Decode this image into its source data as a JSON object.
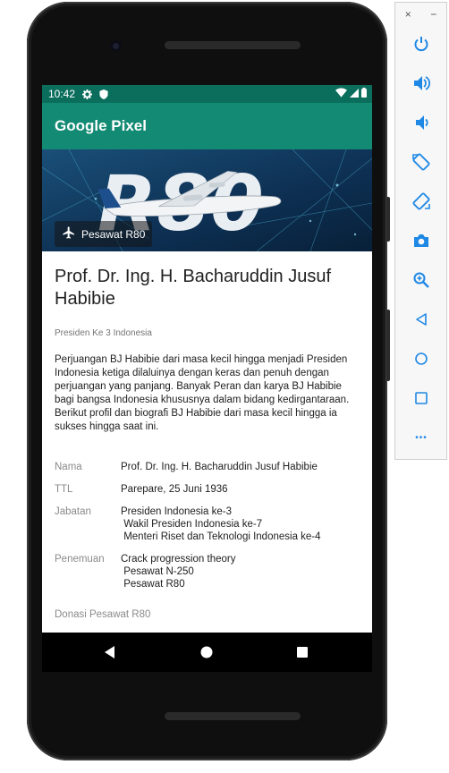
{
  "status_bar": {
    "time": "10:42"
  },
  "app_bar": {
    "title": "Google Pixel"
  },
  "banner": {
    "chip_label": "Pesawat R80",
    "logo_text": "R80"
  },
  "article": {
    "headline": "Prof. Dr. Ing. H. Bacharuddin Jusuf Habibie",
    "subtitle": "Presiden Ke 3 Indonesia",
    "description": "Perjuangan BJ Habibie dari masa kecil hingga menjadi Presiden Indonesia ketiga dilaluinya dengan keras dan penuh dengan perjuangan yang panjang. Banyak Peran dan karya BJ Habibie bagi bangsa Indonesia khususnya dalam bidang kedirgantaraan. Berikut profil dan biografi BJ Habibie dari masa kecil hingga ia sukses hingga saat ini."
  },
  "info": {
    "nama": {
      "label": "Nama",
      "value": "Prof. Dr. Ing. H. Bacharuddin Jusuf Habibie"
    },
    "ttl": {
      "label": "TTL",
      "value": "Parepare, 25 Juni 1936"
    },
    "jabatan": {
      "label": "Jabatan",
      "lines": [
        "Presiden Indonesia ke-3",
        " Wakil Presiden Indonesia ke-7",
        " Menteri Riset dan Teknologi Indonesia ke-4"
      ]
    },
    "penemuan": {
      "label": "Penemuan",
      "lines": [
        "Crack progression theory",
        " Pesawat N-250",
        " Pesawat R80"
      ]
    }
  },
  "donasi": {
    "label": "Donasi Pesawat R80"
  },
  "emulator": {
    "close": "×",
    "minimize": "−",
    "buttons": [
      "power-icon",
      "volume-up-icon",
      "volume-down-icon",
      "rotate-left-icon",
      "rotate-right-icon",
      "camera-icon",
      "zoom-icon",
      "back-icon",
      "home-icon",
      "overview-icon",
      "more-icon"
    ],
    "more": "•••"
  },
  "colors": {
    "status_bar": "#0b6e5d",
    "app_bar": "#138a73",
    "icon": "#1e88e5"
  }
}
